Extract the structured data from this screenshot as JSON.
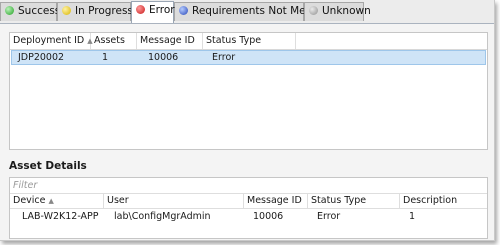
{
  "tabs": [
    {
      "label": "Success",
      "status_color": "#22a022"
    },
    {
      "label": "In Progress",
      "status_color": "#d8b400"
    },
    {
      "label": "Error",
      "status_color": "#c81818",
      "selected": true
    },
    {
      "label": "Requirements Not Met",
      "status_color": "#2646b8"
    },
    {
      "label": "Unknown",
      "status_color": "#8f8f8f"
    }
  ],
  "deployments": {
    "columns": [
      "Deployment ID",
      "Assets",
      "Message ID",
      "Status Type"
    ],
    "rows": [
      {
        "deployment_id": "JDP20002",
        "assets": "1",
        "message_id": "10006",
        "status_type": "Error"
      }
    ]
  },
  "asset_details": {
    "title": "Asset Details",
    "filter_placeholder": "Filter",
    "columns": [
      "Device",
      "User",
      "Message ID",
      "Status Type",
      "Description"
    ],
    "rows": [
      {
        "device": "LAB-W2K12-APP",
        "user": "lab\\ConfigMgrAdmin",
        "message_id": "10006",
        "status_type": "Error",
        "description": "1"
      }
    ]
  }
}
